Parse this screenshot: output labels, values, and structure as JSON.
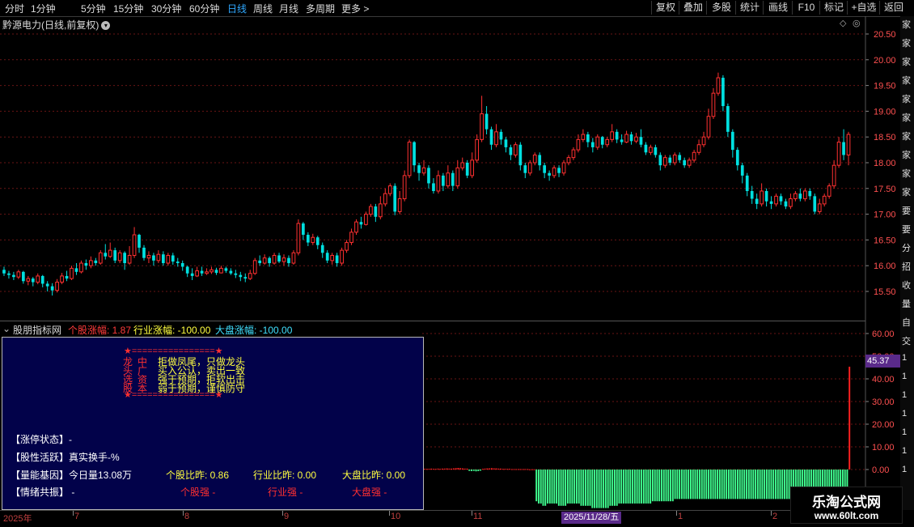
{
  "toolbar": {
    "periods": [
      "分时",
      "1分钟",
      "5分钟",
      "15分钟",
      "30分钟",
      "60分钟",
      "日线",
      "周线",
      "月线",
      "多周期",
      "更多 >"
    ],
    "active_period": "日线",
    "actions": [
      "复权",
      "叠加",
      "多股",
      "统计",
      "画线",
      "F10",
      "标记",
      "+自选",
      "返回"
    ]
  },
  "chart": {
    "title": "黔源电力(日线,前复权)",
    "price_ticks": [
      "20.50",
      "20.00",
      "19.50",
      "19.00",
      "18.50",
      "18.00",
      "17.50",
      "17.00",
      "16.50",
      "16.00",
      "15.50"
    ],
    "ind_ticks": [
      "60.00",
      "50.00",
      "40.00",
      "30.00",
      "20.00",
      "10.00",
      "0.00"
    ],
    "ind_current_value": "45.37",
    "colors": {
      "up": "#ff3030",
      "down": "#00e0e0",
      "vol_up": "#ff2020",
      "vol_down": "#40ff90",
      "grid": "#6a1515"
    }
  },
  "indicator": {
    "name": "股朋指标网",
    "stock_change": "个股涨幅: 1.87",
    "industry_change": "行业涨幅: -100.00",
    "market_change": "大盘涨幅: -100.00"
  },
  "panel": {
    "border_top": "★================★",
    "border_bottom": "★================★",
    "left_col": [
      "龙",
      "头",
      "选",
      "股"
    ],
    "mid_col": [
      "中",
      "广",
      "资",
      "本"
    ],
    "slogans": [
      "拒做凤尾，只做龙头",
      "买入公认，卖出一致",
      "强于预期，拒软出击",
      "弱于预期，谨慎防守"
    ],
    "status_label": "【涨停状态】-",
    "active_label": "【股性活跃】真实换手-%",
    "gene_label": "【量能基因】今日量13.08万",
    "sentiment_label": "【情绪共振】 -",
    "stock_ratio": "个股比昨: 0.86",
    "industry_ratio": "行业比昨: 0.00",
    "market_ratio": "大盘比昨: 0.00",
    "stock_strong": "个股强 -",
    "industry_strong": "行业强 -",
    "market_strong": "大盘强 -"
  },
  "right_strip": [
    "家",
    "家",
    "家",
    "家",
    "家",
    "家",
    "家",
    "家",
    "家",
    "家",
    "要",
    "要",
    "分",
    "招",
    "收",
    "量",
    "自",
    "交",
    "1",
    "1",
    "1",
    "1",
    "1",
    "1",
    "1"
  ],
  "date_axis": {
    "labels": [
      "2025年",
      "7",
      "8",
      "9",
      "10",
      "11",
      "1",
      "2"
    ],
    "cursor": "2025/11/28/五"
  },
  "watermark": {
    "line1": "乐淘公式网",
    "line2": "www.60lt.com"
  },
  "candles": [
    [
      15.92,
      15.85,
      15.98,
      15.8
    ],
    [
      15.85,
      15.82,
      15.9,
      15.75
    ],
    [
      15.82,
      15.78,
      15.88,
      15.72
    ],
    [
      15.78,
      15.88,
      15.92,
      15.74
    ],
    [
      15.88,
      15.7,
      15.9,
      15.65
    ],
    [
      15.7,
      15.75,
      15.8,
      15.62
    ],
    [
      15.75,
      15.68,
      15.78,
      15.6
    ],
    [
      15.68,
      15.8,
      15.85,
      15.64
    ],
    [
      15.8,
      15.65,
      15.82,
      15.58
    ],
    [
      15.65,
      15.6,
      15.7,
      15.5
    ],
    [
      15.6,
      15.52,
      15.66,
      15.42
    ],
    [
      15.52,
      15.68,
      15.74,
      15.48
    ],
    [
      15.68,
      15.8,
      15.86,
      15.64
    ],
    [
      15.8,
      15.75,
      15.9,
      15.7
    ],
    [
      15.75,
      15.95,
      16.0,
      15.72
    ],
    [
      15.95,
      15.88,
      16.05,
      15.82
    ],
    [
      15.88,
      16.05,
      16.1,
      15.85
    ],
    [
      16.05,
      16.0,
      16.12,
      15.92
    ],
    [
      16.0,
      16.1,
      16.18,
      15.95
    ],
    [
      16.1,
      16.05,
      16.15,
      16.0
    ],
    [
      16.05,
      16.25,
      16.3,
      16.02
    ],
    [
      16.25,
      16.18,
      16.42,
      16.12
    ],
    [
      16.18,
      16.3,
      16.45,
      16.15
    ],
    [
      16.3,
      16.1,
      16.35,
      16.05
    ],
    [
      16.1,
      16.25,
      16.3,
      16.05
    ],
    [
      16.25,
      16.05,
      16.28,
      15.92
    ],
    [
      16.05,
      16.2,
      16.38,
      16.02
    ],
    [
      16.2,
      16.6,
      16.75,
      16.15
    ],
    [
      16.6,
      16.35,
      16.62,
      16.25
    ],
    [
      16.35,
      16.15,
      16.4,
      16.1
    ],
    [
      16.15,
      16.2,
      16.28,
      16.05
    ],
    [
      16.2,
      16.1,
      16.25,
      16.0
    ],
    [
      16.1,
      16.22,
      16.3,
      16.05
    ],
    [
      16.22,
      16.05,
      16.28,
      16.0
    ],
    [
      16.05,
      16.2,
      16.25,
      16.0
    ],
    [
      16.2,
      16.08,
      16.25,
      16.02
    ],
    [
      16.08,
      16.05,
      16.15,
      15.98
    ],
    [
      16.05,
      15.98,
      16.1,
      15.9
    ],
    [
      15.98,
      15.85,
      16.0,
      15.78
    ],
    [
      15.85,
      15.8,
      15.95,
      15.72
    ],
    [
      15.8,
      15.9,
      15.98,
      15.78
    ],
    [
      15.9,
      15.85,
      15.98,
      15.8
    ],
    [
      15.85,
      15.88,
      15.95,
      15.82
    ],
    [
      15.88,
      15.92,
      15.98,
      15.84
    ],
    [
      15.92,
      15.86,
      15.96,
      15.82
    ],
    [
      15.86,
      15.95,
      16.0,
      15.85
    ],
    [
      15.95,
      15.9,
      15.98,
      15.86
    ],
    [
      15.9,
      15.85,
      15.95,
      15.82
    ],
    [
      15.85,
      15.82,
      15.92,
      15.76
    ],
    [
      15.82,
      15.78,
      15.88,
      15.7
    ],
    [
      15.78,
      15.75,
      15.85,
      15.68
    ],
    [
      15.75,
      15.85,
      15.92,
      15.72
    ],
    [
      15.85,
      16.1,
      16.15,
      15.82
    ],
    [
      16.1,
      16.05,
      16.2,
      16.0
    ],
    [
      16.05,
      16.15,
      16.22,
      16.02
    ],
    [
      16.15,
      16.05,
      16.18,
      15.98
    ],
    [
      16.05,
      16.2,
      16.25,
      16.02
    ],
    [
      16.2,
      16.08,
      16.25,
      16.05
    ],
    [
      16.08,
      16.15,
      16.22,
      16.0
    ],
    [
      16.15,
      16.05,
      16.2,
      15.98
    ],
    [
      16.05,
      16.25,
      16.3,
      16.02
    ],
    [
      16.25,
      16.82,
      16.9,
      16.2
    ],
    [
      16.82,
      16.6,
      16.85,
      16.5
    ],
    [
      16.6,
      16.45,
      16.65,
      16.38
    ],
    [
      16.45,
      16.55,
      16.62,
      16.4
    ],
    [
      16.55,
      16.4,
      16.58,
      16.32
    ],
    [
      16.4,
      16.25,
      16.45,
      16.15
    ],
    [
      16.25,
      16.1,
      16.3,
      16.05
    ],
    [
      16.1,
      16.2,
      16.25,
      16.02
    ],
    [
      16.2,
      16.05,
      16.25,
      15.98
    ],
    [
      16.05,
      16.3,
      16.35,
      16.0
    ],
    [
      16.3,
      16.45,
      16.5,
      16.25
    ],
    [
      16.45,
      16.65,
      16.72,
      16.4
    ],
    [
      16.65,
      16.85,
      16.9,
      16.6
    ],
    [
      16.85,
      16.8,
      16.95,
      16.72
    ],
    [
      16.8,
      17.0,
      17.05,
      16.78
    ],
    [
      17.0,
      17.15,
      17.2,
      16.95
    ],
    [
      17.15,
      16.95,
      17.2,
      16.85
    ],
    [
      16.95,
      17.2,
      17.35,
      16.9
    ],
    [
      17.2,
      17.4,
      17.5,
      17.15
    ],
    [
      17.4,
      17.55,
      17.6,
      17.35
    ],
    [
      17.55,
      17.05,
      17.6,
      16.98
    ],
    [
      17.05,
      17.3,
      17.45,
      17.0
    ],
    [
      17.3,
      17.75,
      17.85,
      17.25
    ],
    [
      17.75,
      18.4,
      18.45,
      17.7
    ],
    [
      18.4,
      17.95,
      18.42,
      17.82
    ],
    [
      17.95,
      17.8,
      18.0,
      17.65
    ],
    [
      17.8,
      17.9,
      18.05,
      17.75
    ],
    [
      17.9,
      17.6,
      17.95,
      17.5
    ],
    [
      17.6,
      17.45,
      17.7,
      17.4
    ],
    [
      17.45,
      17.75,
      17.85,
      17.4
    ],
    [
      17.75,
      17.55,
      17.8,
      17.45
    ],
    [
      17.55,
      17.8,
      17.95,
      17.5
    ],
    [
      17.8,
      17.55,
      17.85,
      17.45
    ],
    [
      17.55,
      17.9,
      18.05,
      17.5
    ],
    [
      17.9,
      18.0,
      18.1,
      17.85
    ],
    [
      18.0,
      17.75,
      18.05,
      17.7
    ],
    [
      17.75,
      18.05,
      18.2,
      17.7
    ],
    [
      18.05,
      18.45,
      18.55,
      18.0
    ],
    [
      18.45,
      18.95,
      19.3,
      18.4
    ],
    [
      18.95,
      18.65,
      19.1,
      18.55
    ],
    [
      18.65,
      18.35,
      18.7,
      18.25
    ],
    [
      18.35,
      18.6,
      18.75,
      18.3
    ],
    [
      18.6,
      18.45,
      18.65,
      18.35
    ],
    [
      18.45,
      18.3,
      18.5,
      18.2
    ],
    [
      18.3,
      18.15,
      18.35,
      18.05
    ],
    [
      18.15,
      18.35,
      18.4,
      18.1
    ],
    [
      18.35,
      17.95,
      18.4,
      17.85
    ],
    [
      17.95,
      17.8,
      18.0,
      17.7
    ],
    [
      17.8,
      18.0,
      18.05,
      17.75
    ],
    [
      18.0,
      18.15,
      18.2,
      17.95
    ],
    [
      18.15,
      17.95,
      18.2,
      17.85
    ],
    [
      17.95,
      17.8,
      18.0,
      17.7
    ],
    [
      17.8,
      17.75,
      17.85,
      17.65
    ],
    [
      17.75,
      17.9,
      17.95,
      17.7
    ],
    [
      17.9,
      17.8,
      17.95,
      17.72
    ],
    [
      17.8,
      18.0,
      18.05,
      17.75
    ],
    [
      18.0,
      18.1,
      18.15,
      17.95
    ],
    [
      18.1,
      18.25,
      18.3,
      18.05
    ],
    [
      18.25,
      18.45,
      18.55,
      18.2
    ],
    [
      18.45,
      18.55,
      18.65,
      18.4
    ],
    [
      18.55,
      18.4,
      18.6,
      18.3
    ],
    [
      18.4,
      18.3,
      18.48,
      18.2
    ],
    [
      18.3,
      18.5,
      18.55,
      18.25
    ],
    [
      18.5,
      18.35,
      18.52,
      18.28
    ],
    [
      18.35,
      18.45,
      18.5,
      18.3
    ],
    [
      18.45,
      18.6,
      18.75,
      18.4
    ],
    [
      18.6,
      18.45,
      18.65,
      18.38
    ],
    [
      18.45,
      18.4,
      18.55,
      18.35
    ],
    [
      18.4,
      18.55,
      18.62,
      18.38
    ],
    [
      18.55,
      18.42,
      18.6,
      18.35
    ],
    [
      18.42,
      18.5,
      18.58,
      18.38
    ],
    [
      18.5,
      18.35,
      18.65,
      18.3
    ],
    [
      18.35,
      18.2,
      18.4,
      18.15
    ],
    [
      18.2,
      18.3,
      18.35,
      18.15
    ],
    [
      18.3,
      18.15,
      18.35,
      18.1
    ],
    [
      18.15,
      17.95,
      18.2,
      17.85
    ],
    [
      17.95,
      18.1,
      18.15,
      17.9
    ],
    [
      18.1,
      18.0,
      18.15,
      17.95
    ],
    [
      18.0,
      18.15,
      18.2,
      17.95
    ],
    [
      18.15,
      18.05,
      18.2,
      18.0
    ],
    [
      18.05,
      17.95,
      18.1,
      17.9
    ],
    [
      17.95,
      18.05,
      18.1,
      17.9
    ],
    [
      18.05,
      18.2,
      18.25,
      18.0
    ],
    [
      18.2,
      18.35,
      18.45,
      18.15
    ],
    [
      18.35,
      18.5,
      18.6,
      18.3
    ],
    [
      18.5,
      18.9,
      19.05,
      18.45
    ],
    [
      18.9,
      19.35,
      19.45,
      18.85
    ],
    [
      19.35,
      19.65,
      19.75,
      19.3
    ],
    [
      19.65,
      19.1,
      19.7,
      19.0
    ],
    [
      19.1,
      18.6,
      19.15,
      18.5
    ],
    [
      18.6,
      18.25,
      18.65,
      18.1
    ],
    [
      18.25,
      17.95,
      18.3,
      17.85
    ],
    [
      17.95,
      17.75,
      18.0,
      17.6
    ],
    [
      17.75,
      17.45,
      17.8,
      17.35
    ],
    [
      17.45,
      17.3,
      17.55,
      17.2
    ],
    [
      17.3,
      17.2,
      17.4,
      17.1
    ],
    [
      17.2,
      17.45,
      17.6,
      17.15
    ],
    [
      17.45,
      17.25,
      17.5,
      17.15
    ],
    [
      17.25,
      17.2,
      17.35,
      17.1
    ],
    [
      17.2,
      17.35,
      17.4,
      17.15
    ],
    [
      17.35,
      17.25,
      17.4,
      17.18
    ],
    [
      17.25,
      17.15,
      17.3,
      17.1
    ],
    [
      17.15,
      17.3,
      17.4,
      17.1
    ],
    [
      17.3,
      17.4,
      17.45,
      17.25
    ],
    [
      17.4,
      17.3,
      17.5,
      17.25
    ],
    [
      17.3,
      17.45,
      17.5,
      17.25
    ],
    [
      17.45,
      17.35,
      17.5,
      17.28
    ],
    [
      17.35,
      17.05,
      17.4,
      17.0
    ],
    [
      17.05,
      17.2,
      17.3,
      17.0
    ],
    [
      17.2,
      17.35,
      17.4,
      17.15
    ],
    [
      17.35,
      17.55,
      17.6,
      17.3
    ],
    [
      17.55,
      17.95,
      18.05,
      17.5
    ],
    [
      17.95,
      18.4,
      18.5,
      17.9
    ],
    [
      18.4,
      18.15,
      18.65,
      18.05
    ],
    [
      18.15,
      18.55,
      18.6,
      17.95
    ]
  ],
  "ind_bars": [
    0.3,
    0.3,
    0.3,
    0.4,
    0.3,
    0.3,
    0.4,
    0.3,
    0.4,
    0.4,
    0.5,
    0.4,
    0.4,
    0.5,
    0.6,
    0.7,
    0.6,
    0.5,
    0.4,
    0.4,
    -0.6,
    -0.7,
    -0.6,
    -0.8,
    -0.7,
    -0.5,
    0.3,
    0.4,
    0.5,
    0.5,
    0.6,
    0.5,
    0.5,
    0.4,
    0.4,
    0.3,
    0.3,
    0.3,
    0.3,
    0.2,
    0.2,
    0.2,
    0.2,
    0.2,
    0.2,
    0.2,
    0.2,
    0.1,
    0.1,
    0.1,
    -14,
    -15,
    -15,
    -16,
    -16,
    -15,
    -15,
    -15,
    -15,
    -15,
    -16,
    -16,
    -16,
    -16,
    -15,
    -15,
    -15,
    -15,
    -15,
    -15,
    -16,
    -16,
    -16,
    -16,
    -16,
    -17,
    -17,
    -17,
    -17,
    -17,
    -17,
    -17,
    -17,
    -16,
    -16,
    -16,
    -16,
    -15,
    -15,
    -15,
    -15,
    -15,
    -15,
    -15,
    -15,
    -15,
    -15,
    -15,
    -15,
    -15,
    -15,
    -15,
    -14,
    -14,
    -14,
    -14,
    -14,
    -14,
    -14,
    -14,
    -14,
    -14,
    -13,
    -13,
    -13,
    -13,
    -13,
    -13,
    -13,
    -13,
    -13,
    -13,
    -13,
    -13,
    -13,
    -13,
    -13,
    -13,
    -13,
    -13,
    -13,
    -13,
    -13,
    -13,
    -13,
    -13,
    -13,
    -13,
    -13,
    -13,
    -13,
    -13,
    -13,
    -13,
    -13,
    -13,
    -13,
    -13,
    -13,
    -13,
    -13,
    -13,
    -13,
    -13,
    -13,
    -13,
    -13,
    -13,
    -13,
    -13,
    -13,
    -13,
    -13,
    -13,
    -13,
    -13,
    -13,
    -13,
    -13,
    -13,
    -13,
    -13,
    -13,
    -13,
    -13,
    -13,
    -13,
    -13,
    -13,
    -13,
    -13,
    -13,
    -13,
    -13,
    -13,
    -13,
    -13,
    -13,
    -13,
    -13,
    45.37
  ]
}
